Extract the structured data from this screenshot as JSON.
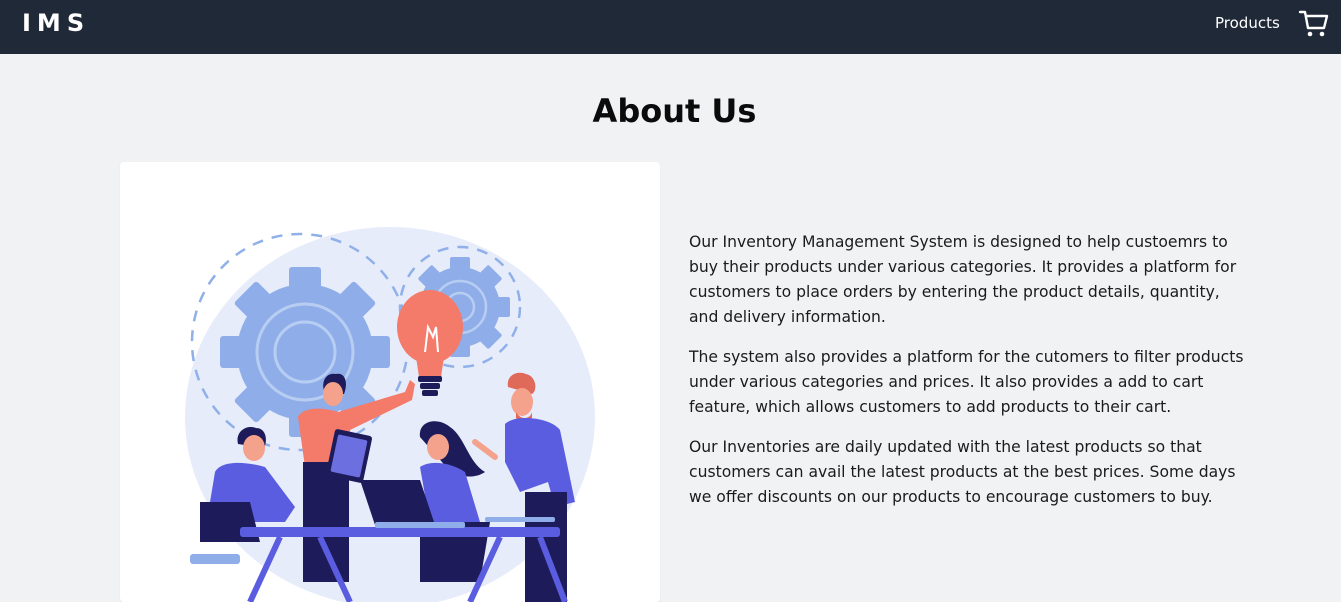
{
  "navbar": {
    "brand": "IMS",
    "links": [
      {
        "label": "Products"
      }
    ],
    "cart_icon": "cart-icon"
  },
  "page": {
    "title": "About Us"
  },
  "about": {
    "image_icon": "team-illustration",
    "paragraphs": [
      "Our Inventory Management System is designed to help custoemrs to buy their products under various categories. It provides a platform for customers to place orders by entering the product details, quantity, and delivery information.",
      "The system also provides a platform for the cutomers to filter products under various categories and prices. It also provides a add to cart feature, which allows customers to add products to their cart.",
      "Our Inventories are daily updated with the latest products so that customers can avail the latest products at the best prices. Some days we offer discounts on our products to encourage customers to buy."
    ]
  }
}
